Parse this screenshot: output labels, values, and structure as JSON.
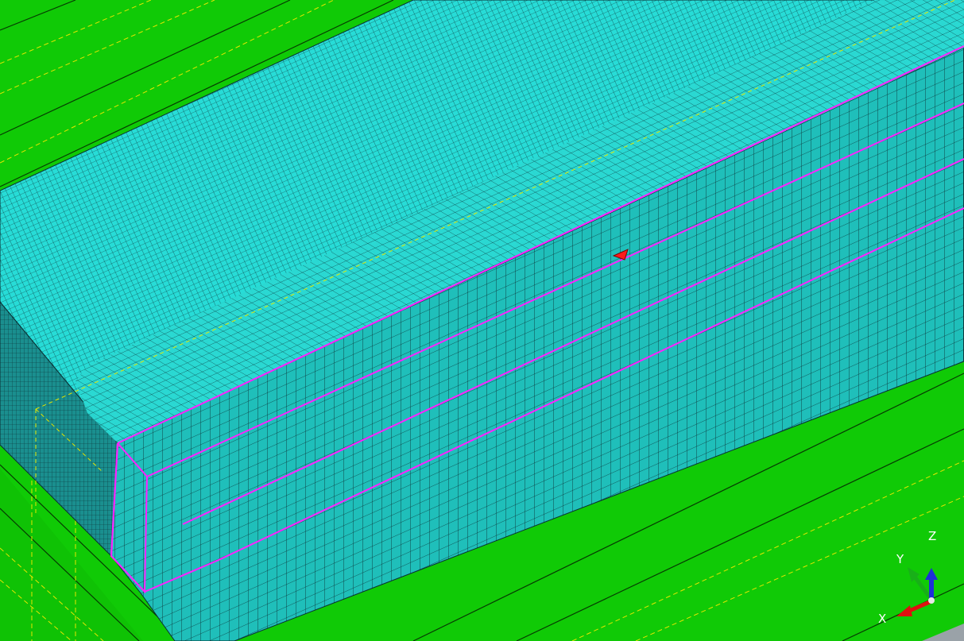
{
  "viewport": {
    "colors": {
      "ground": "#10ca06",
      "ground_dark": "#0b8f04",
      "edge_line": "#063a02",
      "mesh_top": "#27dcd7",
      "mesh_side": "#1fbfba",
      "mesh_end": "#1a8f8f",
      "mesh_line": "#0a2f33",
      "highlight": "#ff22ff",
      "dashed": "#e6e600",
      "marker": "#ff1a1a",
      "corner_gray": "#9aa2a8"
    },
    "marker": {
      "name": "red-arrow-marker"
    },
    "triad": {
      "x_label": "X",
      "y_label": "Y",
      "z_label": "Z",
      "x_color": "#e01010",
      "y_color": "#18b018",
      "z_color": "#1e2fd8"
    }
  }
}
